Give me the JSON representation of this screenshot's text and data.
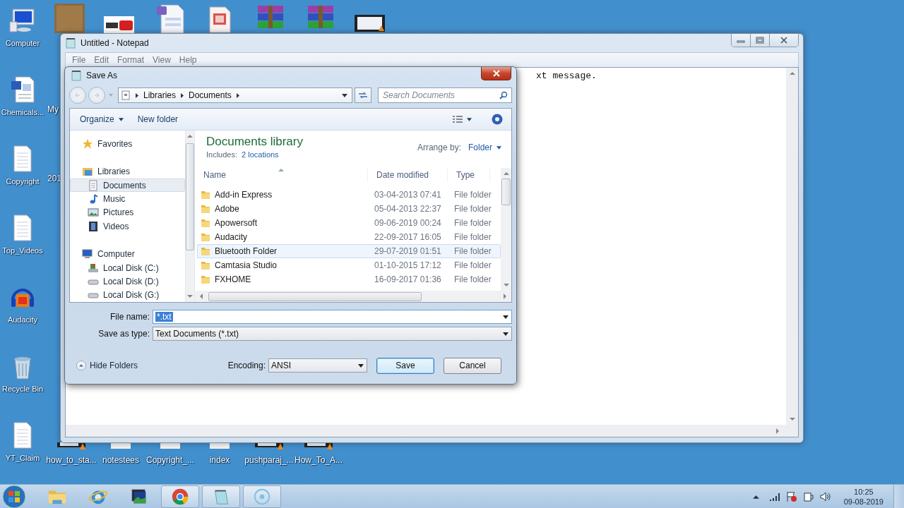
{
  "desktop": {
    "left_icons": [
      {
        "label": "Computer",
        "kind": "computer"
      },
      {
        "label": "Chemicals...",
        "kind": "word"
      },
      {
        "label": "Copyright",
        "kind": "text"
      },
      {
        "label": "Top_Videos",
        "kind": "text"
      },
      {
        "label": "Audacity",
        "kind": "audacity"
      },
      {
        "label": "Recycle Bin",
        "kind": "recycle"
      },
      {
        "label": "YT_Claim",
        "kind": "text"
      }
    ],
    "partial_labels": [
      "My",
      "201"
    ],
    "bottom_icons": [
      {
        "label": "how_to_sta...",
        "kind": "video"
      },
      {
        "label": "notestees",
        "kind": "blank"
      },
      {
        "label": "Copyright_...",
        "kind": "blank"
      },
      {
        "label": "index",
        "kind": "blank"
      },
      {
        "label": "pushparaj_...",
        "kind": "video"
      },
      {
        "label": "How_To_A...",
        "kind": "video"
      }
    ]
  },
  "notepad": {
    "title": "Untitled - Notepad",
    "menu": [
      "File",
      "Edit",
      "Format",
      "View",
      "Help"
    ],
    "text": "xt message."
  },
  "save_as": {
    "title": "Save As",
    "breadcrumb": [
      "Libraries",
      "Documents"
    ],
    "search": {
      "placeholder": "Search Documents"
    },
    "toolbar": {
      "organize": "Organize",
      "new_folder": "New folder"
    },
    "nav": [
      {
        "label": "Favorites",
        "kind": "favorites",
        "selected": false
      },
      {
        "label": "Libraries",
        "kind": "libraries",
        "selected": false,
        "children": [
          {
            "label": "Documents",
            "kind": "documents",
            "selected": true
          },
          {
            "label": "Music",
            "kind": "music",
            "selected": false
          },
          {
            "label": "Pictures",
            "kind": "pictures",
            "selected": false
          },
          {
            "label": "Videos",
            "kind": "videos",
            "selected": false
          }
        ]
      },
      {
        "label": "Computer",
        "kind": "computer",
        "selected": false,
        "children": [
          {
            "label": "Local Disk (C:)",
            "kind": "system-disk",
            "selected": false
          },
          {
            "label": "Local Disk (D:)",
            "kind": "disk",
            "selected": false
          },
          {
            "label": "Local Disk (G:)",
            "kind": "disk",
            "selected": false
          }
        ]
      }
    ],
    "library": {
      "title": "Documents library",
      "includes_label": "Includes:",
      "includes_link": "2 locations",
      "arrange_label": "Arrange by:",
      "arrange_value": "Folder"
    },
    "columns": [
      {
        "label": "Name",
        "sorted": true
      },
      {
        "label": "Date modified",
        "sorted": false
      },
      {
        "label": "Type",
        "sorted": false
      }
    ],
    "rows": [
      {
        "name": "Add-in Express",
        "date": "03-04-2013 07:41",
        "type": "File folder",
        "hovered": false
      },
      {
        "name": "Adobe",
        "date": "05-04-2013 22:37",
        "type": "File folder",
        "hovered": false
      },
      {
        "name": "Apowersoft",
        "date": "09-06-2019 00:24",
        "type": "File folder",
        "hovered": false
      },
      {
        "name": "Audacity",
        "date": "22-09-2017 16:05",
        "type": "File folder",
        "hovered": false
      },
      {
        "name": "Bluetooth Folder",
        "date": "29-07-2019 01:51",
        "type": "File folder",
        "hovered": true
      },
      {
        "name": "Camtasia Studio",
        "date": "01-10-2015 17:12",
        "type": "File folder",
        "hovered": false
      },
      {
        "name": "FXHOME",
        "date": "16-09-2017 01:36",
        "type": "File folder",
        "hovered": false
      }
    ],
    "file_name": {
      "label": "File name:",
      "value": "*.txt"
    },
    "save_as_type": {
      "label": "Save as type:",
      "value": "Text Documents (*.txt)"
    },
    "hide_folders": "Hide Folders",
    "encoding": {
      "label": "Encoding:",
      "value": "ANSI"
    },
    "buttons": [
      {
        "label": "Save",
        "kind": "default"
      },
      {
        "label": "Cancel",
        "kind": "normal"
      }
    ]
  },
  "taskbar": {
    "apps": [
      {
        "kind": "explorer",
        "running": false
      },
      {
        "kind": "ie",
        "running": false
      },
      {
        "kind": "media",
        "running": false
      },
      {
        "kind": "chrome",
        "running": true
      },
      {
        "kind": "notepad",
        "running": true
      },
      {
        "kind": "disc",
        "running": true
      }
    ],
    "clock": {
      "time": "10:25",
      "date": "09-08-2019"
    }
  }
}
